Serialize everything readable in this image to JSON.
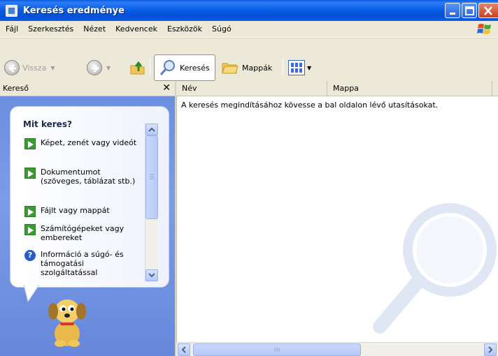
{
  "window": {
    "title": "Keresés eredménye"
  },
  "menu": [
    "Fájl",
    "Szerkesztés",
    "Nézet",
    "Kedvencek",
    "Eszközök",
    "Súgó"
  ],
  "toolbar": {
    "back_label": "Vissza",
    "search_label": "Keresés",
    "folders_label": "Mappák"
  },
  "left_pane": {
    "header": "Kereső",
    "close_glyph": "✕",
    "heading": "Mit keres?",
    "options": [
      "Képet, zenét vagy videót",
      "Dokumentumot (szöveges, táblázat stb.)",
      "Fájlt vagy mappát",
      "Számítógépeket vagy embereket",
      "Információ a súgó- és támogatási szolgáltatással"
    ]
  },
  "results": {
    "columns": [
      "Név",
      "Mappa"
    ],
    "message": "A keresés megindításához kövesse a bal oldalon lévő utasításokat."
  },
  "colors": {
    "titlebar": "#0a5fe6",
    "chrome": "#ece9d8",
    "search_pane": "#7c9ce6"
  }
}
